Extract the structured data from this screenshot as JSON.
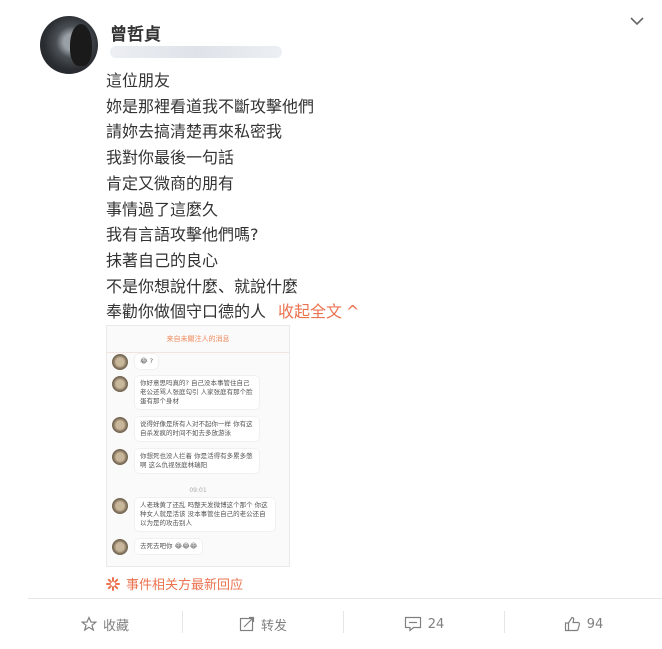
{
  "post": {
    "username": "曾哲貞",
    "lines": [
      "這位朋友",
      "妳是那裡看道我不斷攻擊他們",
      "請妳去搞清楚再來私密我",
      "我對你最後一句話",
      "肯定又微商的朋有",
      "事情過了這麼久",
      "我有言語攻擊他們嗎?",
      "抹著自己的良心",
      "不是你想說什麼、就說什麼",
      "奉勸你做個守口德的人"
    ],
    "collapse_label": "收起全文",
    "collapse_arrow": "^"
  },
  "screenshot": {
    "header": "来自未關注人的消息",
    "messages": [
      "😂 ?",
      "你好意思吗真的? 自己没本事管住自己老公还骂人张庭勾引 人家张庭有那个脸蛋有那个身材",
      "说得好像是所有人对不起你一样 你有这自杀发疯的时间不如去多放游泳",
      "你想死也没人拦着 你是活得有多累多憋啊 这么仇视张庭林瑞阳",
      "人老珠黄了还乱 吗整天发微博这个那个 你这种女人就是活该 没本事管住自己的老公还自以为是的攻击别人",
      "去死去吧你 😂😂😂"
    ],
    "timestamp": "09:01"
  },
  "related_label": "事件相关方最新回应",
  "actions": {
    "favorite_label": "收藏",
    "repost_label": "转发",
    "comment_count": "24",
    "like_count": "94"
  },
  "colors": {
    "accent": "#eb7350",
    "muted": "#808080"
  }
}
